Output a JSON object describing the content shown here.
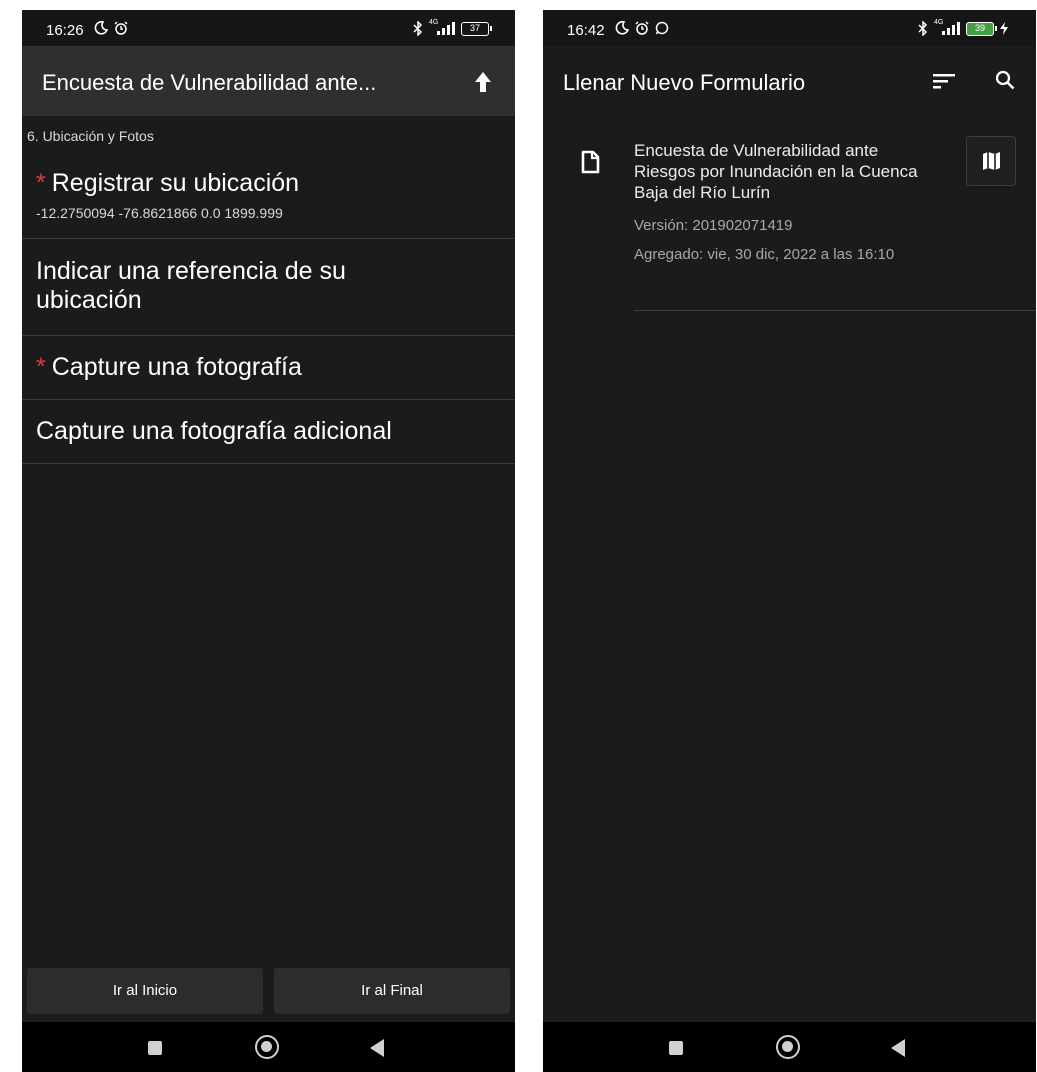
{
  "left_screen": {
    "status": {
      "time": "16:26",
      "network": "4G",
      "battery": "37"
    },
    "appbar": {
      "title": "Encuesta de Vulnerabilidad ante..."
    },
    "section_label": "6. Ubicación y Fotos",
    "questions": [
      {
        "required": "*",
        "label": "Registrar su ubicación",
        "value": "-12.2750094 -76.8621866 0.0 1899.999"
      },
      {
        "label": "Indicar una referencia de su ubicación"
      },
      {
        "required": "*",
        "label": "Capture una fotografía"
      },
      {
        "label": "Capture una fotografía adicional"
      }
    ],
    "buttons": {
      "start": "Ir al Inicio",
      "end": "Ir al Final"
    }
  },
  "right_screen": {
    "status": {
      "time": "16:42",
      "network": "4G",
      "battery": "39"
    },
    "appbar": {
      "title": "Llenar Nuevo Formulario"
    },
    "form": {
      "title": "Encuesta de Vulnerabilidad ante Riesgos por Inundación en la Cuenca Baja del Río Lurín",
      "version": "Versión: 201902071419",
      "added": "Agregado: vie, 30 dic, 2022 a las 16:10"
    }
  },
  "icons": [
    "moon-icon",
    "alarm-icon",
    "whatsapp-icon",
    "bluetooth-icon",
    "signal-icon",
    "battery-icon",
    "charging-icon",
    "upload-icon",
    "sort-icon",
    "search-icon",
    "document-icon",
    "map-icon",
    "recents-icon",
    "home-icon",
    "back-icon"
  ],
  "colors": {
    "background": "#1b1b1b",
    "appbar": "#2f2f2f",
    "required": "#e53935",
    "navbar": "#000000"
  }
}
